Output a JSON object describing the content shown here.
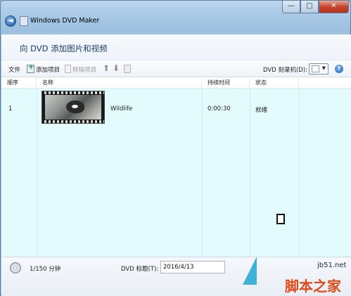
{
  "window": {
    "title": "Windows DVD Maker",
    "back_glyph": "◄",
    "min_glyph": "—",
    "max_glyph": "□",
    "close_glyph": "✕"
  },
  "header": {
    "title": "向 DVD 添加图片和视频"
  },
  "toolbar": {
    "file_label": "文件",
    "add_label": "添加项目",
    "remove_label": "移除项目",
    "up_glyph": "⬆",
    "down_glyph": "⬇",
    "burner_label": "DVD 刻录机(D):",
    "burner_arrow": "▼",
    "help_glyph": "?"
  },
  "table": {
    "columns": [
      "顺序",
      "名称",
      "持续时间",
      "状态"
    ],
    "rows": [
      {
        "order": "1",
        "name": "Wildlife",
        "duration": "0:00:30",
        "status": "就绪"
      }
    ]
  },
  "footer": {
    "usage": "1/150 分钟",
    "title_label": "DVD 标题(T):",
    "title_value": "2016/4/13"
  },
  "watermark": {
    "site": "jb51.net",
    "name": "脚本之家"
  },
  "colors": {
    "list_background": "#e3fbfd",
    "header_text": "#1a3e6e",
    "watermark_orange": "#e24a1a",
    "watermark_blue": "#3fb3d6"
  },
  "icons": {
    "back": "back-arrow-icon",
    "app": "dvd-maker-icon",
    "add": "add-item-icon",
    "remove": "remove-item-icon",
    "move_up": "move-up-icon",
    "move_down": "move-down-icon",
    "export": "export-icon",
    "help": "help-icon",
    "disc": "disc-icon"
  }
}
